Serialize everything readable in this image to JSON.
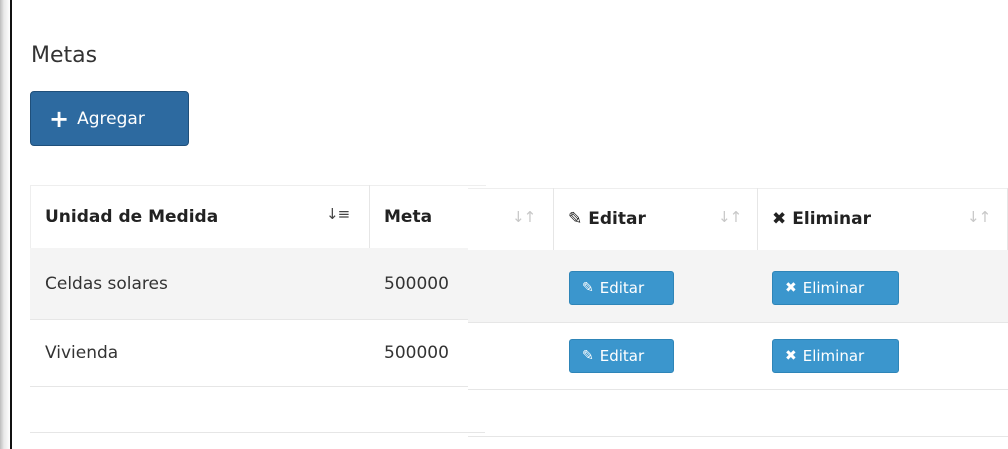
{
  "page": {
    "title": "Metas"
  },
  "toolbar": {
    "add_label": "Agregar"
  },
  "table": {
    "columns": {
      "unidad": "Unidad de Medida",
      "meta": "Meta",
      "editar": "Editar",
      "eliminar": "Eliminar"
    },
    "rows": [
      {
        "unidad": "Celdas solares",
        "meta": "500000",
        "edit_label": "Editar",
        "delete_label": "Eliminar"
      },
      {
        "unidad": "Vivienda",
        "meta": "500000",
        "edit_label": "Editar",
        "delete_label": "Eliminar"
      }
    ]
  },
  "colors": {
    "primary": "#2d6aa0",
    "info": "#3b96cd",
    "stripe": "#f4f4f4"
  }
}
